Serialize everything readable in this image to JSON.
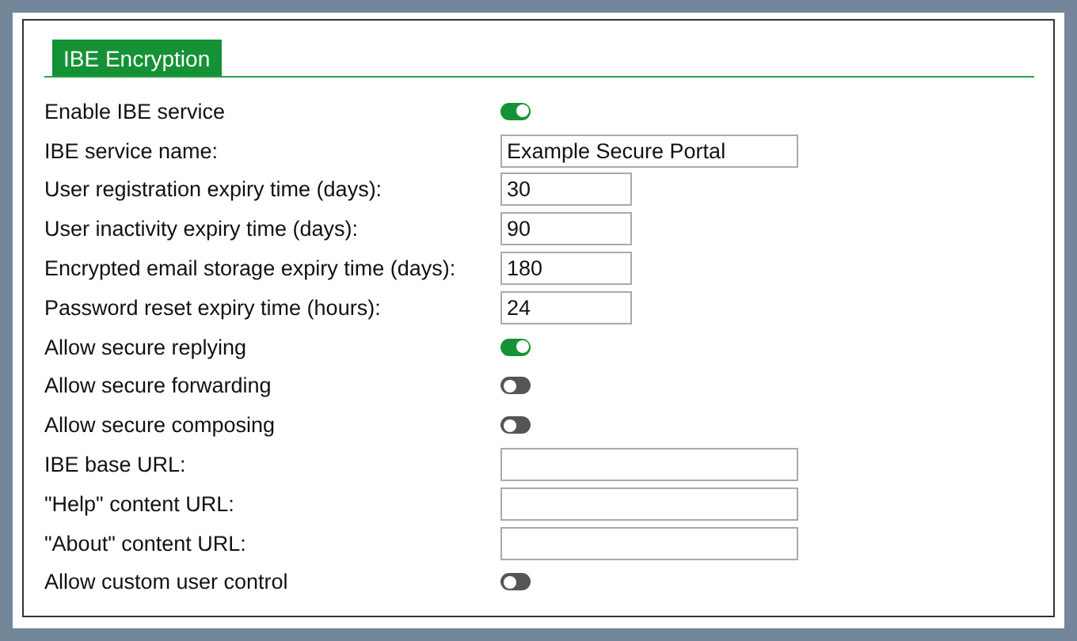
{
  "tab": {
    "label": "IBE Encryption",
    "selected": true
  },
  "rows": [
    {
      "kind": "toggle",
      "label": "Enable IBE service",
      "on": true
    },
    {
      "kind": "text",
      "label": "IBE service name:",
      "value": "Example Secure Portal"
    },
    {
      "kind": "number",
      "label": "User registration expiry time (days):",
      "value": "30"
    },
    {
      "kind": "number",
      "label": "User inactivity expiry time (days):",
      "value": "90"
    },
    {
      "kind": "number",
      "label": "Encrypted email storage expiry time (days):",
      "value": "180"
    },
    {
      "kind": "number",
      "label": "Password reset expiry time (hours):",
      "value": "24"
    },
    {
      "kind": "toggle",
      "label": "Allow secure replying",
      "on": true
    },
    {
      "kind": "toggle",
      "label": "Allow secure forwarding",
      "on": false
    },
    {
      "kind": "toggle",
      "label": "Allow secure composing",
      "on": false
    },
    {
      "kind": "text",
      "label": "IBE base URL:"
    },
    {
      "kind": "text",
      "label": "\"Help\" content URL:"
    },
    {
      "kind": "text",
      "label": "\"About\" content URL:"
    },
    {
      "kind": "toggle",
      "label": "Allow custom user control",
      "on": false
    }
  ]
}
